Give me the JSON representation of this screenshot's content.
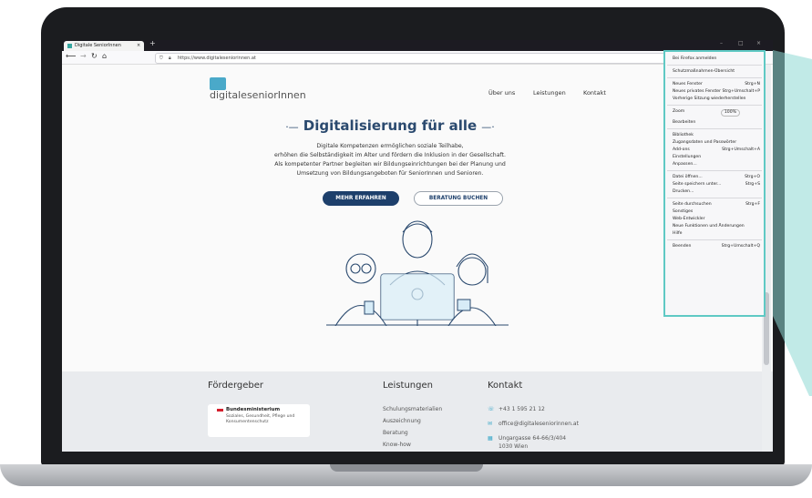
{
  "browser": {
    "tab_title": "Digitale SeniorInnen",
    "url": "https://www.digitaleseniorinnen.at"
  },
  "site": {
    "logo_text": "digitaleseniorInnen",
    "nav": [
      "Über uns",
      "Leistungen",
      "Kontakt"
    ],
    "hero_title": "Digitalisierung für alle",
    "hero_lines": [
      "Digitale Kompetenzen ermöglichen soziale Teilhabe,",
      "erhöhen die Selbständigkeit im Alter und fördern die Inklusion in der Gesellschaft.",
      "Als kompetenter Partner begleiten wir Bildungseinrichtungen bei der Planung und",
      "Umsetzung von Bildungsangeboten für SeniorInnen und Senioren."
    ],
    "button_primary": "MEHR ERFAHREN",
    "button_secondary": "BERATUNG BUCHEN"
  },
  "footer": {
    "foerdergeber_heading": "Fördergeber",
    "ministry_title": "Bundesministerium",
    "ministry_sub": "Soziales, Gesundheit, Pflege und Konsumentenschutz",
    "leistungen_heading": "Leistungen",
    "leistungen_items": [
      "Schulungsmaterialien",
      "Auszeichnung",
      "Beratung",
      "Know-how"
    ],
    "kontakt_heading": "Kontakt",
    "phone": "+43 1 595 21 12",
    "email": "office@digitaleseniorinnen.at",
    "address1": "Ungargasse 64-66/3/404",
    "address2": "1030 Wien"
  },
  "menu": {
    "items": [
      {
        "label": "Bei Firefox anmelden",
        "shortcut": ""
      },
      {
        "label": "Schutzmaßnahmen-Übersicht",
        "shortcut": ""
      },
      {
        "label": "Neues Fenster",
        "shortcut": "Strg+N"
      },
      {
        "label": "Neues privates Fenster",
        "shortcut": "Strg+Umschalt+P"
      },
      {
        "label": "Vorherige Sitzung wiederherstellen",
        "shortcut": ""
      },
      {
        "label": "Zoom",
        "shortcut": ""
      },
      {
        "label": "Bearbeiten",
        "shortcut": ""
      },
      {
        "label": "Bibliothek",
        "shortcut": ""
      },
      {
        "label": "Zugangsdaten und Passwörter",
        "shortcut": ""
      },
      {
        "label": "Add-ons",
        "shortcut": "Strg+Umschalt+A"
      },
      {
        "label": "Einstellungen",
        "shortcut": ""
      },
      {
        "label": "Anpassen...",
        "shortcut": ""
      },
      {
        "label": "Datei öffnen...",
        "shortcut": "Strg+O"
      },
      {
        "label": "Seite speichern unter...",
        "shortcut": "Strg+S"
      },
      {
        "label": "Drucken...",
        "shortcut": ""
      },
      {
        "label": "Seite durchsuchen",
        "shortcut": "Strg+F"
      },
      {
        "label": "Sonstiges",
        "shortcut": ""
      },
      {
        "label": "Web-Entwickler",
        "shortcut": ""
      },
      {
        "label": "Neue Funktionen und Änderungen",
        "shortcut": ""
      },
      {
        "label": "Hilfe",
        "shortcut": ""
      },
      {
        "label": "Beenden",
        "shortcut": "Strg+Umschalt+Q"
      }
    ],
    "zoom_value": "100%"
  },
  "colors": {
    "accent": "#1d3f6b",
    "highlight": "#5fc9c4"
  }
}
